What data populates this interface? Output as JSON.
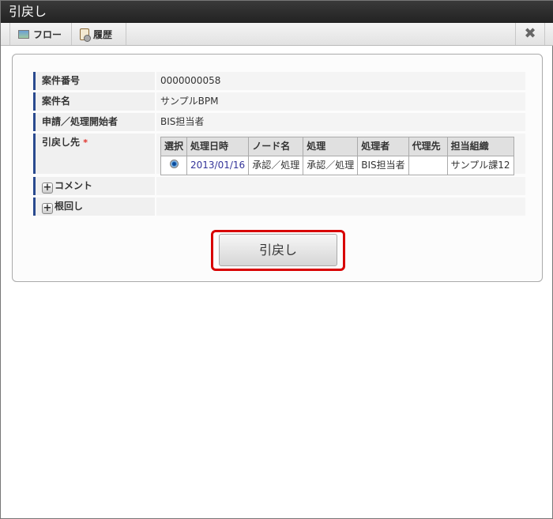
{
  "window": {
    "title": "引戻し",
    "close_icon": "close-x-icon"
  },
  "toolbar": {
    "items": [
      {
        "label": "フロー",
        "icon": "flow-image-icon"
      },
      {
        "label": "履歴",
        "icon": "history-clipboard-icon"
      }
    ]
  },
  "form": {
    "matter_number": {
      "label": "案件番号",
      "value": "0000000058"
    },
    "matter_name": {
      "label": "案件名",
      "value": "サンプルBPM"
    },
    "applicant": {
      "label": "申請／処理開始者",
      "value": "BIS担当者"
    },
    "pullback_target": {
      "label": "引戻し先",
      "required_mark": "*",
      "table": {
        "headers": [
          "選択",
          "処理日時",
          "ノード名",
          "処理",
          "処理者",
          "代理先",
          "担当組織"
        ],
        "rows": [
          {
            "selected": true,
            "date": "2013/01/16",
            "node": "承認／処理",
            "action": "承認／処理",
            "user": "BIS担当者",
            "proxy": "",
            "org": "サンプル課12"
          }
        ]
      }
    },
    "comment": {
      "label": "コメント",
      "expand_icon": "plus-icon"
    },
    "nemawashi": {
      "label": "根回し",
      "expand_icon": "plus-icon"
    }
  },
  "actions": {
    "pullback_label": "引戻し"
  },
  "colors": {
    "highlight": "#d80000",
    "label_accent": "#2a4a8f",
    "required": "#e0302a"
  }
}
